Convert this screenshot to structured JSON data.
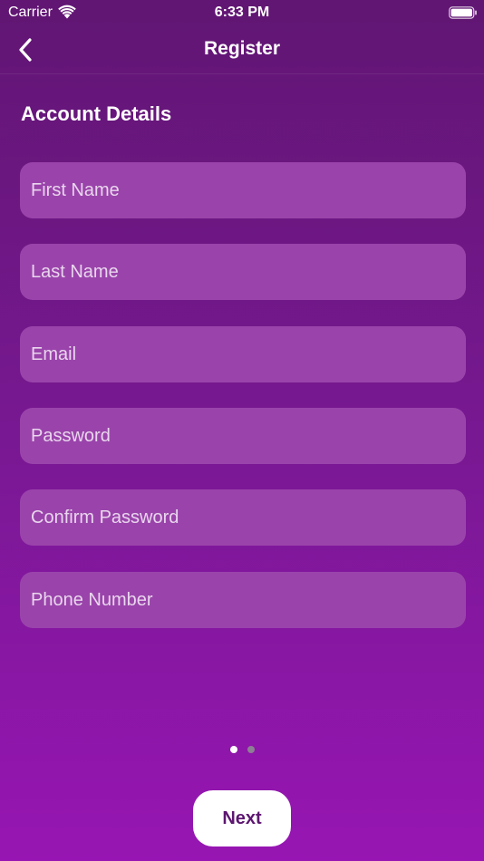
{
  "status_bar": {
    "carrier": "Carrier",
    "time": "6:33 PM",
    "wifi_icon": "wifi-icon",
    "battery_icon": "battery-icon"
  },
  "nav": {
    "title": "Register",
    "back_icon": "chevron-left-icon"
  },
  "form": {
    "section_title": "Account Details",
    "fields": [
      {
        "placeholder": "First Name",
        "value": ""
      },
      {
        "placeholder": "Last Name",
        "value": ""
      },
      {
        "placeholder": "Email",
        "value": ""
      },
      {
        "placeholder": "Password",
        "value": ""
      },
      {
        "placeholder": "Confirm Password",
        "value": ""
      },
      {
        "placeholder": "Phone Number",
        "value": ""
      }
    ]
  },
  "pager": {
    "current_page": 1,
    "total_pages": 2
  },
  "actions": {
    "next_label": "Next"
  },
  "colors": {
    "background_top": "#611673",
    "background_bottom": "#9716b3",
    "field_fill": "#9a44ab",
    "button_text": "#5c1670"
  }
}
